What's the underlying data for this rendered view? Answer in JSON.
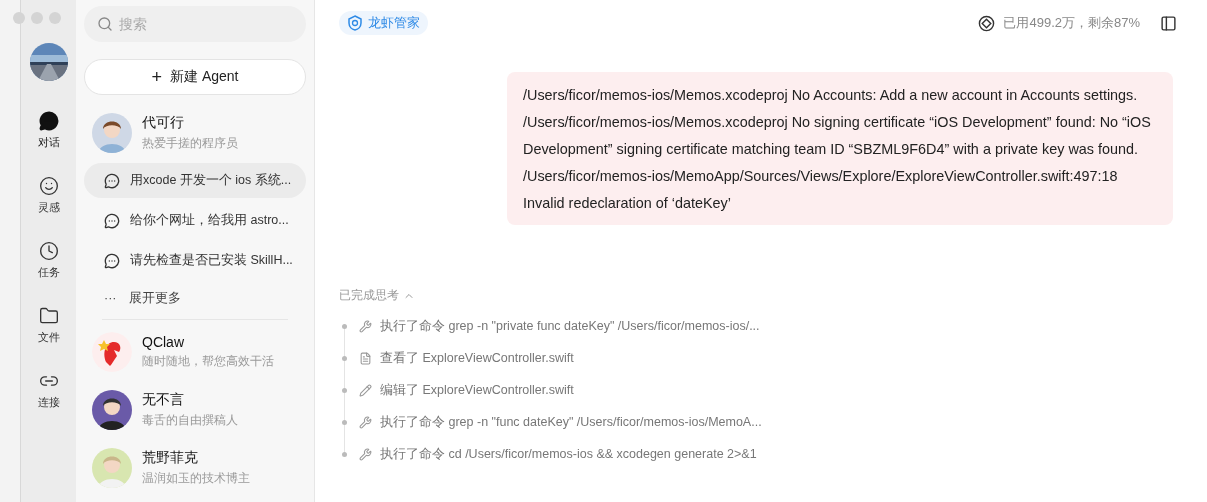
{
  "rail": {
    "items": [
      {
        "label": "对话",
        "selected": true
      },
      {
        "label": "灵感",
        "selected": false
      },
      {
        "label": "任务",
        "selected": false
      },
      {
        "label": "文件",
        "selected": false
      },
      {
        "label": "连接",
        "selected": false
      }
    ]
  },
  "sidebar": {
    "search": {
      "placeholder": "搜索"
    },
    "new_button": {
      "icon": "+",
      "label": "新建 Agent"
    },
    "agents": [
      {
        "name": "代可行",
        "subtitle": "热爱手搓的程序员",
        "chats": [
          {
            "title": "用xcode 开发一个 ios 系统...",
            "selected": true
          },
          {
            "title": "给你个网址，给我用 astro...",
            "selected": false
          },
          {
            "title": "请先检查是否已安装 SkillH...",
            "selected": false
          }
        ],
        "more": {
          "icon": "···",
          "label": "展开更多"
        }
      },
      {
        "name": "QClaw",
        "subtitle": "随时随地，帮您高效干活"
      },
      {
        "name": "无不言",
        "subtitle": "毒舌的自由撰稿人"
      },
      {
        "name": "荒野菲克",
        "subtitle": "温润如玉的技术博主"
      }
    ]
  },
  "header": {
    "badge": "龙虾管家",
    "usage": "已用499.2万，剩余87%"
  },
  "message": {
    "lines": [
      "/Users/ficor/memos-ios/Memos.xcodeproj No Accounts: Add a new account in Accounts settings.",
      "/Users/ficor/memos-ios/Memos.xcodeproj No signing certificate “iOS Development” found: No “iOS Development” signing certificate matching team ID “SBZML9F6D4” with a private key was found.",
      "/Users/ficor/memos-ios/MemoApp/Sources/Views/Explore/ExploreViewController.swift:497:18",
      "Invalid redeclaration of ‘dateKey’"
    ]
  },
  "thinking": {
    "title": "已完成思考",
    "expanded": true,
    "steps": [
      {
        "kind": "command",
        "text": "执行了命令 grep -n \"private func dateKey\" /Users/ficor/memos-ios/..."
      },
      {
        "kind": "view",
        "text": "查看了 ExploreViewController.swift"
      },
      {
        "kind": "edit",
        "text": "编辑了 ExploreViewController.swift"
      },
      {
        "kind": "command",
        "text": "执行了命令 grep -n \"func dateKey\" /Users/ficor/memos-ios/MemoA..."
      },
      {
        "kind": "command",
        "text": "执行了命令 cd /Users/ficor/memos-ios && xcodegen generate 2>&1"
      }
    ]
  }
}
